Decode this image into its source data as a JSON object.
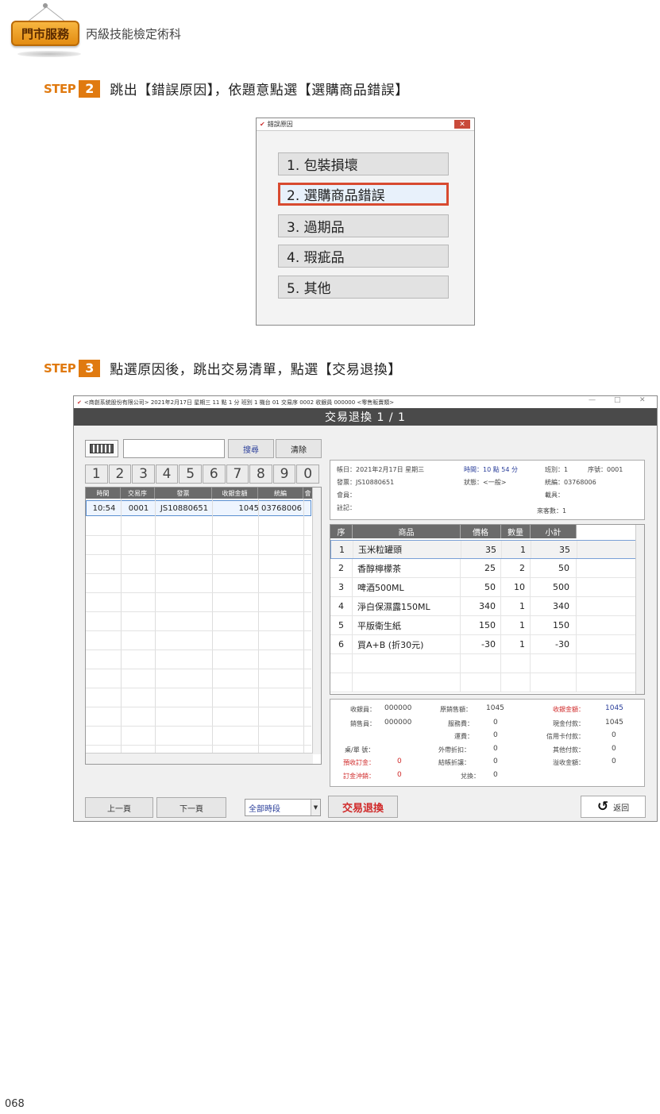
{
  "header": {
    "badge": "門市服務",
    "subtitle": "丙級技能檢定術科"
  },
  "step2": {
    "label": "STEP",
    "number": "2",
    "text": "跳出【錯誤原因】，依題意點選【選購商品錯誤】"
  },
  "reason_dialog": {
    "title": "錯誤原因",
    "close": "✕",
    "options": [
      "1. 包裝損壞",
      "2. 選購商品錯誤",
      "3. 過期品",
      "4. 瑕疵品",
      "5. 其他"
    ],
    "selected_index": 1
  },
  "step3": {
    "label": "STEP",
    "number": "3",
    "text": "點選原因後，跳出交易清單，點選【交易退換】"
  },
  "pos": {
    "title_bar": "<商創系統股份有限公司> 2021年2月17日 星期三 11 點 1 分 班別 1 機台 01 交易序 0002 收銀員 000000 <零售販賣類>",
    "window_controls": [
      "—",
      "□",
      "✕"
    ],
    "heading": "交易退換 1 / 1",
    "search_button": "搜尋",
    "clear_button": "清除",
    "keypad": [
      "1",
      "2",
      "3",
      "4",
      "5",
      "6",
      "7",
      "8",
      "9",
      "0"
    ],
    "list_columns": [
      "時間",
      "交易序",
      "發票",
      "收銀金額",
      "統編",
      "會"
    ],
    "list_row": {
      "time": "10:54",
      "seq": "0001",
      "invoice": "JS10880651",
      "amount": "1045",
      "tax_id": "03768006"
    },
    "info": {
      "date": "帳日：2021年2月17日 星期三",
      "time": "時間：10 點 54 分",
      "shift": "班別：1",
      "serial": "序號：0001",
      "invoice": "發票：JS10880651",
      "status": "狀態：<一般>",
      "tax_id": "統編：03768006",
      "member": "會員：",
      "carrier": "載具：",
      "note": "註記：",
      "visitors": "來客數：1"
    },
    "item_columns": [
      "序",
      "商品",
      "價格",
      "數量",
      "小計"
    ],
    "items": [
      {
        "no": "1",
        "name": "玉米粒罐頭",
        "price": "35",
        "qty": "1",
        "subtotal": "35"
      },
      {
        "no": "2",
        "name": "香醇檸檬茶",
        "price": "25",
        "qty": "2",
        "subtotal": "50"
      },
      {
        "no": "3",
        "name": "啤酒500ML",
        "price": "50",
        "qty": "10",
        "subtotal": "500"
      },
      {
        "no": "4",
        "name": "淨白保濕露150ML",
        "price": "340",
        "qty": "1",
        "subtotal": "340"
      },
      {
        "no": "5",
        "name": "平版衛生紙",
        "price": "150",
        "qty": "1",
        "subtotal": "150"
      },
      {
        "no": "6",
        "name": "買A+B (折30元)",
        "price": "-30",
        "qty": "1",
        "subtotal": "-30"
      }
    ],
    "summary": {
      "cashier_label": "收銀員：",
      "cashier": "000000",
      "sales_label": "銷售員：",
      "sales": "000000",
      "table_label": "桌/單 號：",
      "deposit_label": "預收訂金：",
      "deposit": "0",
      "deposit_offset_label": "訂金沖銷：",
      "deposit_offset": "0",
      "orig_sales_label": "原銷售額：",
      "orig_sales": "1045",
      "service_label": "服務費：",
      "service": "0",
      "shipping_label": "運費：",
      "shipping": "0",
      "ext_discount_label": "外帶折扣：",
      "ext_discount": "0",
      "checkout_discount_label": "結帳折讓：",
      "checkout_discount": "0",
      "change_label": "兌換：",
      "change": "0",
      "received_label": "收銀金額：",
      "received": "1045",
      "cash_label": "現金付款：",
      "cash": "1045",
      "credit_label": "信用卡付款：",
      "credit": "0",
      "other_label": "其他付款：",
      "other": "0",
      "overpay_label": "溢收金額：",
      "overpay": "0"
    },
    "prev_button": "上一頁",
    "next_button": "下一頁",
    "period_select": "全部時段",
    "trade_button": "交易退換",
    "back_button": "返回"
  },
  "page_number": "068"
}
